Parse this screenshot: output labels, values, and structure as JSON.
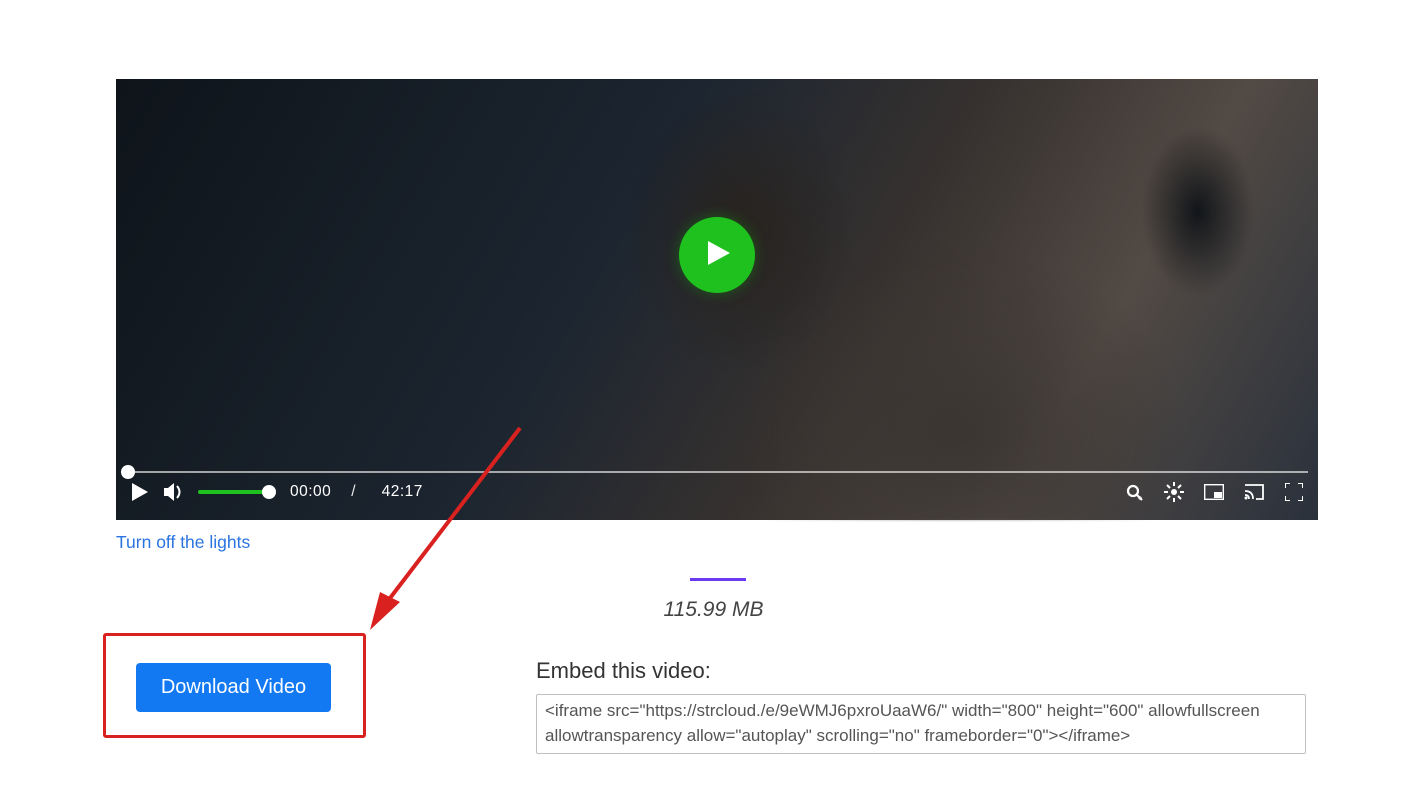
{
  "player": {
    "current_time": "00:00",
    "time_separator": "/",
    "duration": "42:17"
  },
  "lights_link": "Turn off the lights",
  "filesize": "115.99 MB",
  "embed": {
    "label": "Embed this video:",
    "code": "<iframe src=\"https://strcloud./e/9eWMJ6pxroUaaW6/\" width=\"800\" height=\"600\" allowfullscreen allowtransparency allow=\"autoplay\" scrolling=\"no\" frameborder=\"0\"></iframe>"
  },
  "download_button": "Download Video",
  "colors": {
    "accent_green": "#1fc11f",
    "link_blue": "#2a74e0",
    "button_blue": "#1279f2",
    "highlight_red": "#d9221f",
    "divider_purple": "#6a3bf0"
  }
}
